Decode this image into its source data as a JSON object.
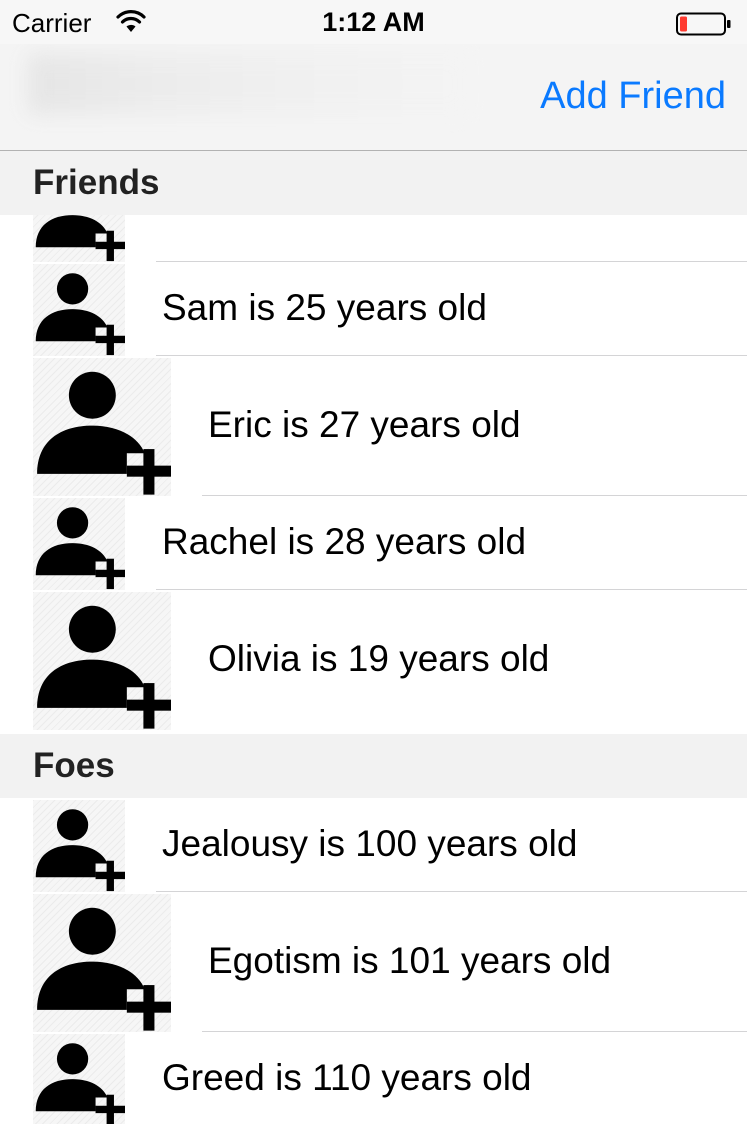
{
  "status_bar": {
    "carrier": "Carrier",
    "time": "1:12 AM",
    "battery_color": "#ff3b30"
  },
  "nav_bar": {
    "add_button_label": "Add Friend",
    "tint_color": "#0a7aff"
  },
  "sections": [
    {
      "title": "Friends",
      "rows": [
        {
          "label": "",
          "size": "partial"
        },
        {
          "label": "Sam is 25 years old",
          "size": "small"
        },
        {
          "label": "Eric is 27 years old",
          "size": "large"
        },
        {
          "label": "Rachel is 28 years old",
          "size": "small"
        },
        {
          "label": "Olivia is 19 years old",
          "size": "large"
        }
      ]
    },
    {
      "title": "Foes",
      "rows": [
        {
          "label": "Jealousy is 100 years old",
          "size": "small"
        },
        {
          "label": "Egotism is 101 years old",
          "size": "large"
        },
        {
          "label": "Greed is 110 years old",
          "size": "small"
        }
      ]
    }
  ],
  "icons": {
    "row_avatar": "add-user-icon",
    "wifi": "wifi-icon",
    "battery": "battery-icon"
  }
}
